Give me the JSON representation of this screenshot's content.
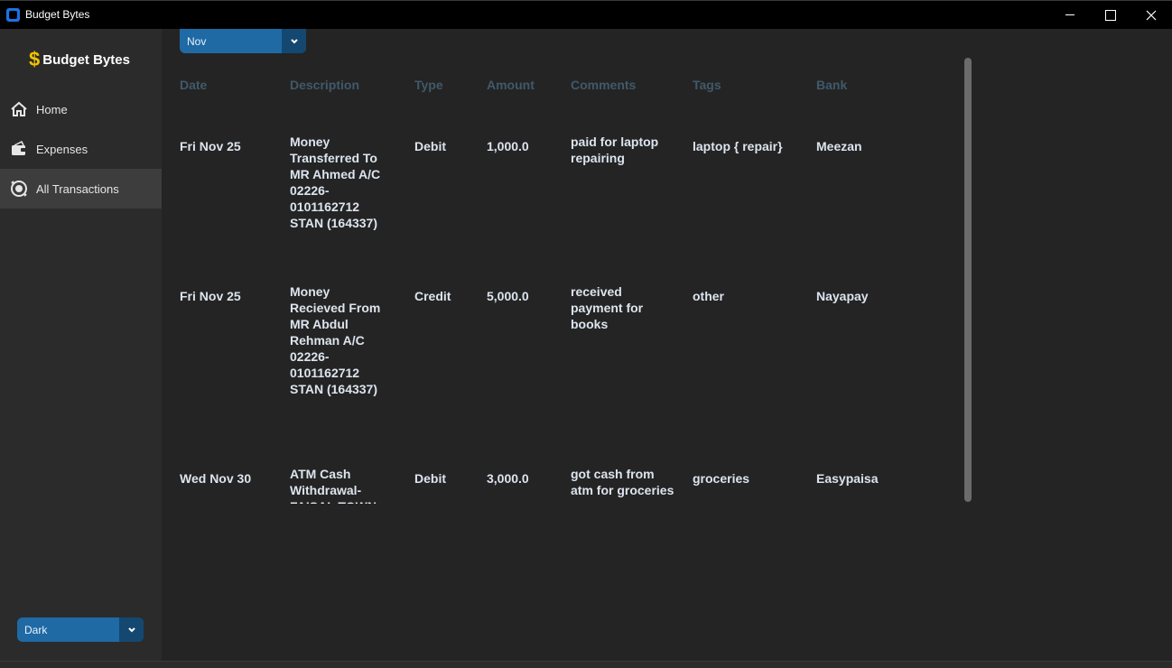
{
  "window": {
    "title": "Budget Bytes"
  },
  "sidebar": {
    "logo_text": "Budget Bytes",
    "logo_symbol": "$",
    "items": [
      {
        "label": "Home",
        "icon": "home-icon"
      },
      {
        "label": "Expenses",
        "icon": "wallet-icon"
      },
      {
        "label": "All Transactions",
        "icon": "transactions-icon"
      }
    ],
    "theme": {
      "value": "Dark"
    }
  },
  "filter": {
    "month": "Nov"
  },
  "table": {
    "headers": [
      "Date",
      "Description",
      "Type",
      "Amount",
      "Comments",
      "Tags",
      "Bank"
    ],
    "rows": [
      {
        "date": "Fri Nov 25",
        "description": "Money Transferred To MR Ahmed A/C 02226-0101162712 STAN (164337)",
        "type": "Debit",
        "amount": "1,000.0",
        "comments": "paid for laptop repairing",
        "tags": "laptop { repair}",
        "bank": "Meezan"
      },
      {
        "date": "Fri Nov 25",
        "description": "Money Recieved From MR Abdul Rehman A/C 02226-0101162712 STAN (164337)",
        "type": "Credit",
        "amount": "5,000.0",
        "comments": "received payment for books",
        "tags": "other",
        "bank": "Nayapay"
      },
      {
        "date": "Wed Nov 30",
        "description": "ATM Cash Withdrawal-FAISAL TOWN",
        "type": "Debit",
        "amount": "3,000.0",
        "comments": "got cash from atm for groceries",
        "tags": "groceries",
        "bank": "Easypaisa"
      }
    ]
  },
  "colors": {
    "accent": "#1f6aa5",
    "accent_dark": "#144870",
    "header_text": "#41596a",
    "logo_gold": "#f2c200"
  }
}
